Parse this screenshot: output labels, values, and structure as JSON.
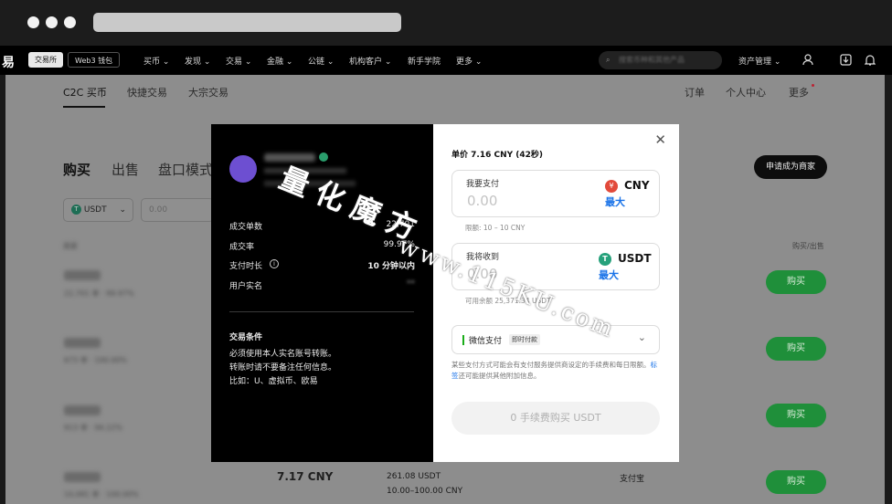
{
  "topnav": {
    "logo": "易",
    "exchange_tab": "交易所",
    "web3_tab": "Web3 钱包",
    "items": [
      "买币 ⌄",
      "发现 ⌄",
      "交易 ⌄",
      "金融 ⌄",
      "公链 ⌄",
      "机构客户 ⌄",
      "新手学院",
      "更多 ⌄"
    ],
    "search_placeholder": "搜索币种和其他产品",
    "asset_mgmt": "资产管理 ⌄"
  },
  "subnav": {
    "tabs": [
      "C2C 买币",
      "快捷交易",
      "大宗交易"
    ],
    "right": [
      "订单",
      "个人中心",
      "更多"
    ]
  },
  "market": {
    "tabs": [
      "购买",
      "出售",
      "盘口模式"
    ],
    "coin_filter": "USDT",
    "amount_placeholder": "0.00",
    "merchant_button": "申请成为商家",
    "col_merchant": "商家",
    "col_action": "购买/出售",
    "rows": [
      {
        "stats": "22,701 单 · 99.97%",
        "action": "购买"
      },
      {
        "stats": "673 单 · 100.00%",
        "action": "购买"
      },
      {
        "stats": "913 单 · 94.22%",
        "action": "购买"
      },
      {
        "stats": "10,081 单 · 100.00%",
        "action": "购买",
        "price": "7.17 CNY",
        "available": "261.08 USDT",
        "limit": "10.00–100.00 CNY",
        "payment": "支付宝"
      }
    ]
  },
  "modal": {
    "left": {
      "stats": [
        {
          "label": "成交单数",
          "value": "22,701"
        },
        {
          "label": "成交率",
          "value": "99.97%"
        },
        {
          "label": "支付时长",
          "value": "10 分钟以内"
        },
        {
          "label": "用户实名",
          "value": "**"
        }
      ],
      "terms_title": "交易条件",
      "terms": [
        "必须使用本人实名账号转账。",
        "转账时请不要备注任何信息。",
        "比如：U、虚拟币、欧易"
      ]
    },
    "right": {
      "price_line": "单价 7.16 CNY (42秒)",
      "pay_label": "我要支付",
      "pay_placeholder": "0.00",
      "pay_currency": "CNY",
      "max_label": "最大",
      "limit_text": "限额: 10 – 10 CNY",
      "receive_label": "我将收到",
      "receive_placeholder": "0.00",
      "receive_currency": "USDT",
      "available_text": "可用余额 25,371.34 USDT",
      "payment_method": "微信支付",
      "payment_badge": "即时付款",
      "note_part1": "某些支付方式可能会有支付服务提供商设定的手续费和每日限额。",
      "note_link": "标签",
      "note_part2": "还可能提供其他附加信息。",
      "submit_label": "0 手续费购买 USDT"
    }
  },
  "watermark": {
    "line1": "量化魔方",
    "line2": "www.115KU.com"
  },
  "colors": {
    "buy_green": "#1f8f3a",
    "usdt_teal": "#26a17b",
    "cny_red": "#e24a3b",
    "link_blue": "#1a73e8",
    "avatar_purple": "#6d4fd1"
  }
}
